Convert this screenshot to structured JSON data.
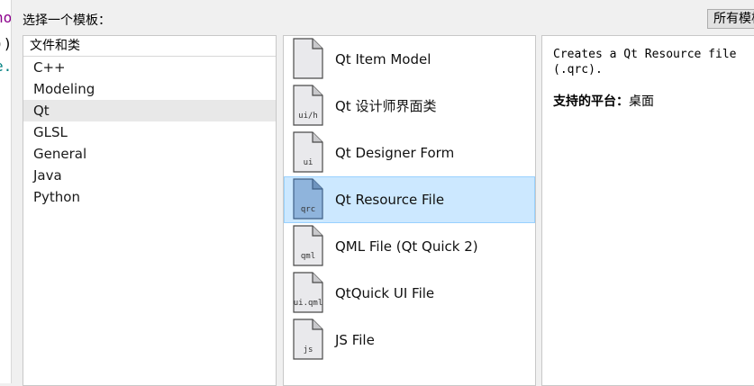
{
  "editor_fragments": [
    {
      "text": "no",
      "color": "#8b008b"
    },
    {
      "text": "));",
      "color": "#000000"
    },
    {
      "text": "e.",
      "color": "#008080"
    }
  ],
  "dialog": {
    "prompt": "选择一个模板：",
    "filter_label": "所有模板"
  },
  "categories": {
    "header": "文件和类",
    "items": [
      "C++",
      "Modeling",
      "Qt",
      "GLSL",
      "General",
      "Java",
      "Python"
    ],
    "selected": "Qt"
  },
  "templates": [
    {
      "label": "Qt Item Model",
      "icon_text": "",
      "icon": "file-icon"
    },
    {
      "label": "Qt 设计师界面类",
      "icon_text": "ui/h",
      "icon": "file-icon"
    },
    {
      "label": "Qt Designer Form",
      "icon_text": "ui",
      "icon": "file-icon"
    },
    {
      "label": "Qt Resource File",
      "icon_text": "qrc",
      "icon": "file-icon",
      "selected": true
    },
    {
      "label": "QML File (Qt Quick 2)",
      "icon_text": "qml",
      "icon": "file-icon"
    },
    {
      "label": "QtQuick UI File",
      "icon_text": "ui.qml",
      "icon": "file-icon"
    },
    {
      "label": "JS File",
      "icon_text": "js",
      "icon": "file-icon"
    }
  ],
  "description": {
    "text": "Creates a Qt Resource file (.qrc).",
    "platforms_label": "支持的平台：",
    "platforms_value": "桌面"
  },
  "colors": {
    "selection_bg": "#cce8ff",
    "selection_border": "#99d1ff",
    "category_selected_bg": "#e8e8e8"
  }
}
